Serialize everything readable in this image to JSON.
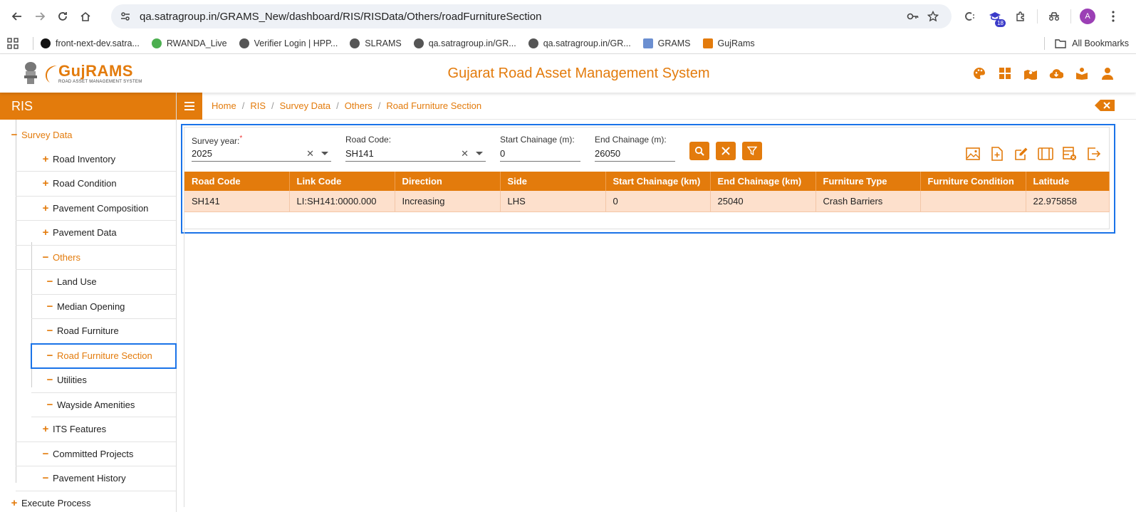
{
  "browser": {
    "url": "qa.satragroup.in/GRAMS_New/dashboard/RIS/RISData/Others/roadFurnitureSection",
    "profile_initial": "A",
    "ext_badge": "18",
    "bookmarks": [
      {
        "label": "front-next-dev.satra...",
        "color": "#111111"
      },
      {
        "label": "RWANDA_Live",
        "color": "#4caf50"
      },
      {
        "label": "Verifier Login | HPP...",
        "color": "#555555"
      },
      {
        "label": "SLRAMS",
        "color": "#555555"
      },
      {
        "label": "qa.satragroup.in/GR...",
        "color": "#555555"
      },
      {
        "label": "qa.satragroup.in/GR...",
        "color": "#555555"
      },
      {
        "label": "GRAMS",
        "color": "#6b8fd1"
      },
      {
        "label": "GujRams",
        "color": "#e37b0c"
      }
    ],
    "all_bookmarks": "All Bookmarks"
  },
  "header": {
    "logo_main": "GujRAMS",
    "logo_sub": "ROAD ASSET MANAGEMENT SYSTEM",
    "title": "Gujarat Road Asset Management System"
  },
  "sidebar": {
    "title": "RIS",
    "survey_data": "Survey Data",
    "items": [
      {
        "label": "Road Inventory",
        "sign": "+"
      },
      {
        "label": "Road Condition",
        "sign": "+"
      },
      {
        "label": "Pavement Composition",
        "sign": "+"
      },
      {
        "label": "Pavement Data",
        "sign": "+"
      },
      {
        "label": "Others",
        "sign": "−"
      }
    ],
    "others_children": [
      "Land Use",
      "Median Opening",
      "Road Furniture",
      "Road Furniture Section",
      "Utilities",
      "Wayside Amenities"
    ],
    "after_items": [
      {
        "label": "ITS Features",
        "sign": "+"
      },
      {
        "label": "Committed Projects",
        "sign": "−"
      },
      {
        "label": "Pavement History",
        "sign": "−"
      }
    ],
    "execute_process": "Execute Process"
  },
  "breadcrumb": [
    "Home",
    "RIS",
    "Survey Data",
    "Others",
    "Road Furniture Section"
  ],
  "filters": {
    "survey_year_label": "Survey year:",
    "survey_year_value": "2025",
    "road_code_label": "Road Code:",
    "road_code_value": "SH141",
    "start_label": "Start Chainage (m):",
    "start_value": "0",
    "end_label": "End Chainage (m):",
    "end_value": "26050"
  },
  "table": {
    "columns": [
      "Road Code",
      "Link Code",
      "Direction",
      "Side",
      "Start Chainage (km)",
      "End Chainage (km)",
      "Furniture Type",
      "Furniture Condition",
      "Latitude"
    ],
    "rows": [
      [
        "SH141",
        "LI:SH141:0000.000",
        "Increasing",
        "LHS",
        "0",
        "25040",
        "Crash Barriers",
        "",
        "22.975858"
      ]
    ]
  },
  "colors": {
    "accent": "#e37b0c",
    "focus": "#1a73e8",
    "row": "#fde0cc"
  }
}
